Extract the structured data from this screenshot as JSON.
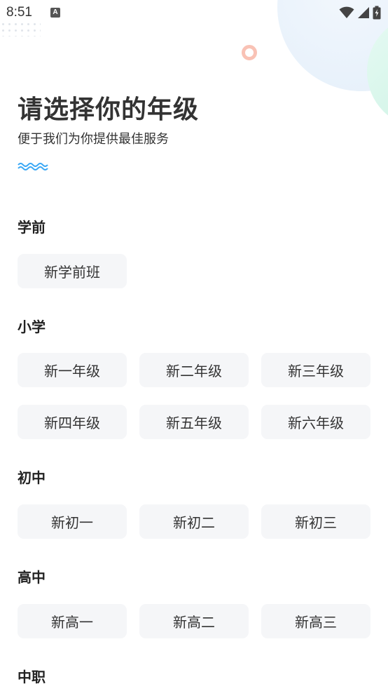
{
  "status_bar": {
    "time": "8:51",
    "notification_icon": "A"
  },
  "header": {
    "title": "请选择你的年级",
    "subtitle": "便于我们为你提供最佳服务"
  },
  "sections": [
    {
      "title": "学前",
      "grades": [
        "新学前班"
      ]
    },
    {
      "title": "小学",
      "grades": [
        "新一年级",
        "新二年级",
        "新三年级",
        "新四年级",
        "新五年级",
        "新六年级"
      ]
    },
    {
      "title": "初中",
      "grades": [
        "新初一",
        "新初二",
        "新初三"
      ]
    },
    {
      "title": "高中",
      "grades": [
        "新高一",
        "新高二",
        "新高三"
      ]
    },
    {
      "title": "中职",
      "grades": []
    }
  ],
  "colors": {
    "accent_wave": "#3aa8f5",
    "button_bg": "#f5f6f8",
    "ring": "#f9c2b5"
  }
}
